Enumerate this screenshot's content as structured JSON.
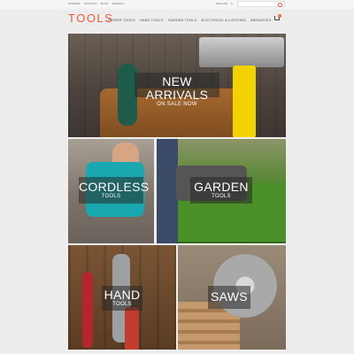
{
  "util": {
    "links": [
      "SITEMAP",
      "CONTACT",
      "BLOG",
      "SEARCH"
    ],
    "language": "ENGLISH",
    "currency": "$",
    "search_placeholder": "Search"
  },
  "header": {
    "logo": "TOOLS",
    "nav": [
      "POWER TOOLS",
      "HAND TOOLS",
      "GARDEN TOOLS",
      "ELECTRICAL & LIGHTING",
      "ABRASIVES"
    ],
    "cart_count": "0"
  },
  "tiles": [
    {
      "title": "NEW ARRIVALS",
      "subtitle": "ON SALE NOW"
    },
    {
      "title": "CORDLESS",
      "subtitle": "TOOLS"
    },
    {
      "title": "GARDEN",
      "subtitle": "TOOLS"
    },
    {
      "title": "HAND",
      "subtitle": "TOOLS"
    },
    {
      "title": "SAWS",
      "subtitle": ""
    }
  ],
  "colors": {
    "accent": "#e8573b",
    "background": "#ededed"
  }
}
